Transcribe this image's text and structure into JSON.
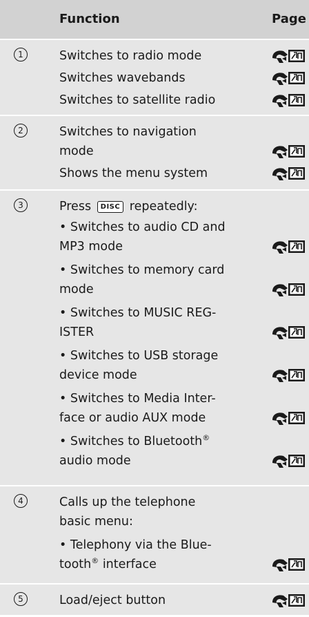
{
  "header": {
    "function_label": "Function",
    "page_label": "Page"
  },
  "rows": [
    {
      "number": "1",
      "lines": [
        "Switches to radio mode",
        "Switches wavebands",
        "Switches to satellite radio"
      ]
    },
    {
      "number": "2",
      "lines": [
        "Switches to navigation",
        "mode",
        "Shows the menu system"
      ]
    },
    {
      "number": "3",
      "press_before": "Press",
      "key_label": "DISC",
      "press_after": "repeatedly:",
      "lines": [
        "• Switches to audio CD and",
        "MP3 mode",
        "• Switches to memory card",
        "mode",
        "• Switches to MUSIC REG-",
        "ISTER",
        "• Switches to USB storage",
        "device mode",
        "• Switches to Media Inter-",
        "face or audio AUX mode",
        "• Switches to Bluetooth",
        "audio mode"
      ],
      "registered": "®"
    },
    {
      "number": "4",
      "lines": [
        "Calls up the telephone",
        "basic menu:",
        "• Telephony via the Blue-",
        "tooth",
        "interface"
      ],
      "registered": "®"
    },
    {
      "number": "5",
      "lines": [
        "Load/eject button"
      ]
    }
  ],
  "icons": {
    "page_reference": "page-reference-icon"
  }
}
